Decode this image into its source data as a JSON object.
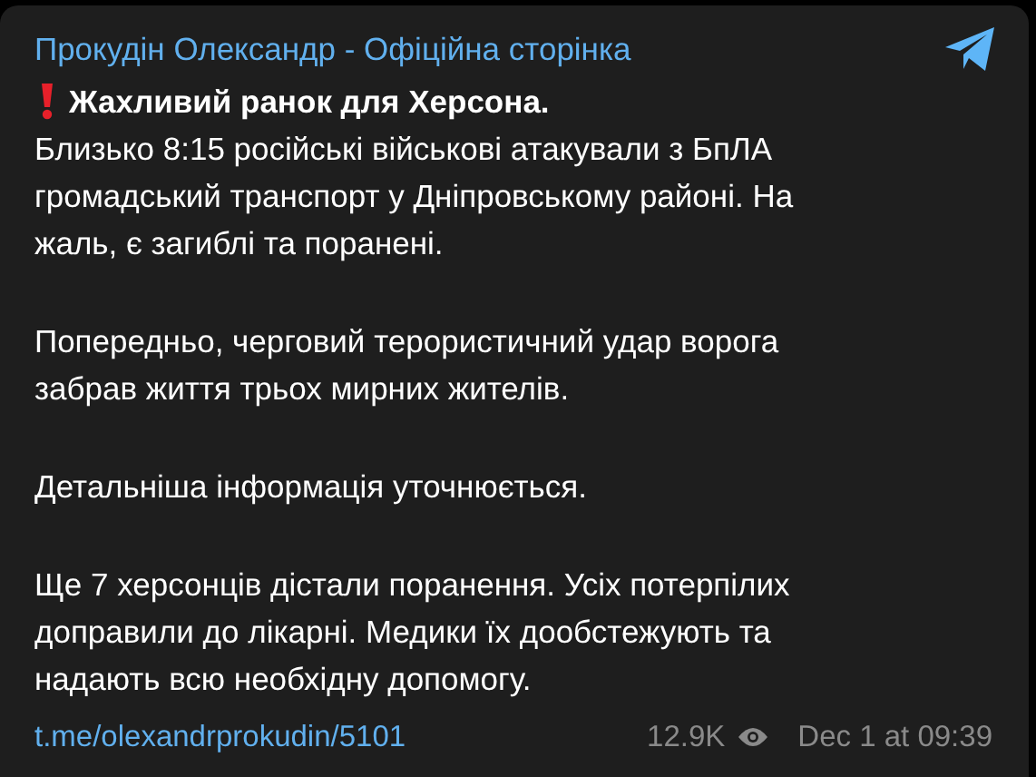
{
  "post": {
    "channel": "Прокудін Олександр - Офіційна сторінка",
    "heading": "Жахливий ранок для Херсона.",
    "paragraphs": [
      "Близько 8:15 російські військові атакували з БпЛА\nгромадський транспорт у Дніпровському районі. На\nжаль, є загиблі та поранені.",
      "Попередньо, черговий терористичний удар ворога\nзабрав життя трьох мирних жителів.",
      "Детальніша інформація уточнюється.",
      "Ще 7 херсонців дістали поранення. Усіх потерпілих\nдоправили до лікарні. Медики їх дообстежують та\nнадають всю необхідну допомогу."
    ],
    "link": "t.me/olexandrprokudin/5101",
    "views": "12.9K",
    "date": "Dec 1 at 09:39"
  }
}
